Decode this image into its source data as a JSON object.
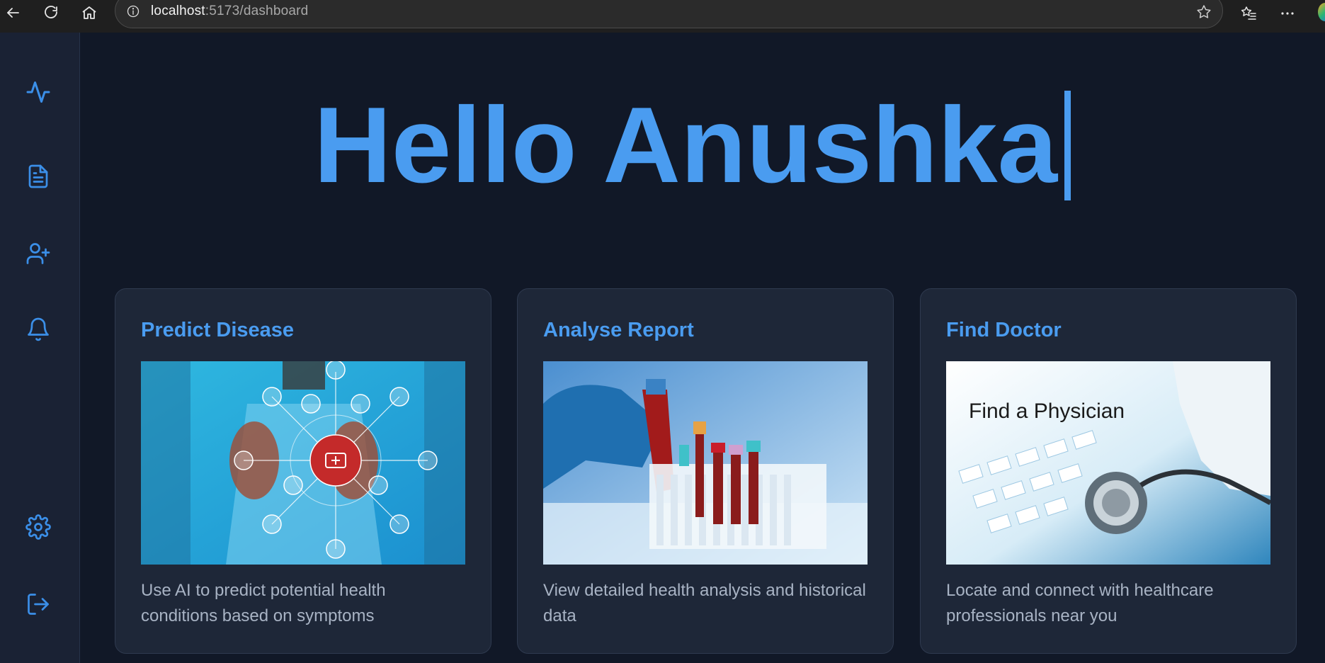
{
  "browser": {
    "url_host": "localhost",
    "url_path": ":5173/dashboard"
  },
  "sidebar": {
    "items": [
      {
        "icon": "activity-icon"
      },
      {
        "icon": "file-text-icon"
      },
      {
        "icon": "user-plus-icon"
      },
      {
        "icon": "bell-icon"
      },
      {
        "icon": "gear-icon"
      },
      {
        "icon": "logout-icon"
      }
    ]
  },
  "main": {
    "greeting": "Hello Anushka"
  },
  "cards": [
    {
      "title": "Predict Disease",
      "description": "Use AI to predict potential health conditions based on symptoms"
    },
    {
      "title": "Analyse Report",
      "description": "View detailed health analysis and historical data"
    },
    {
      "title": "Find Doctor",
      "image_text": "Find a Physician",
      "description": "Locate and connect with healthcare professionals near you"
    }
  ],
  "colors": {
    "accent": "#4a9cf0",
    "background": "#111827",
    "card": "#1e2738",
    "sidebar": "#1a2234"
  }
}
